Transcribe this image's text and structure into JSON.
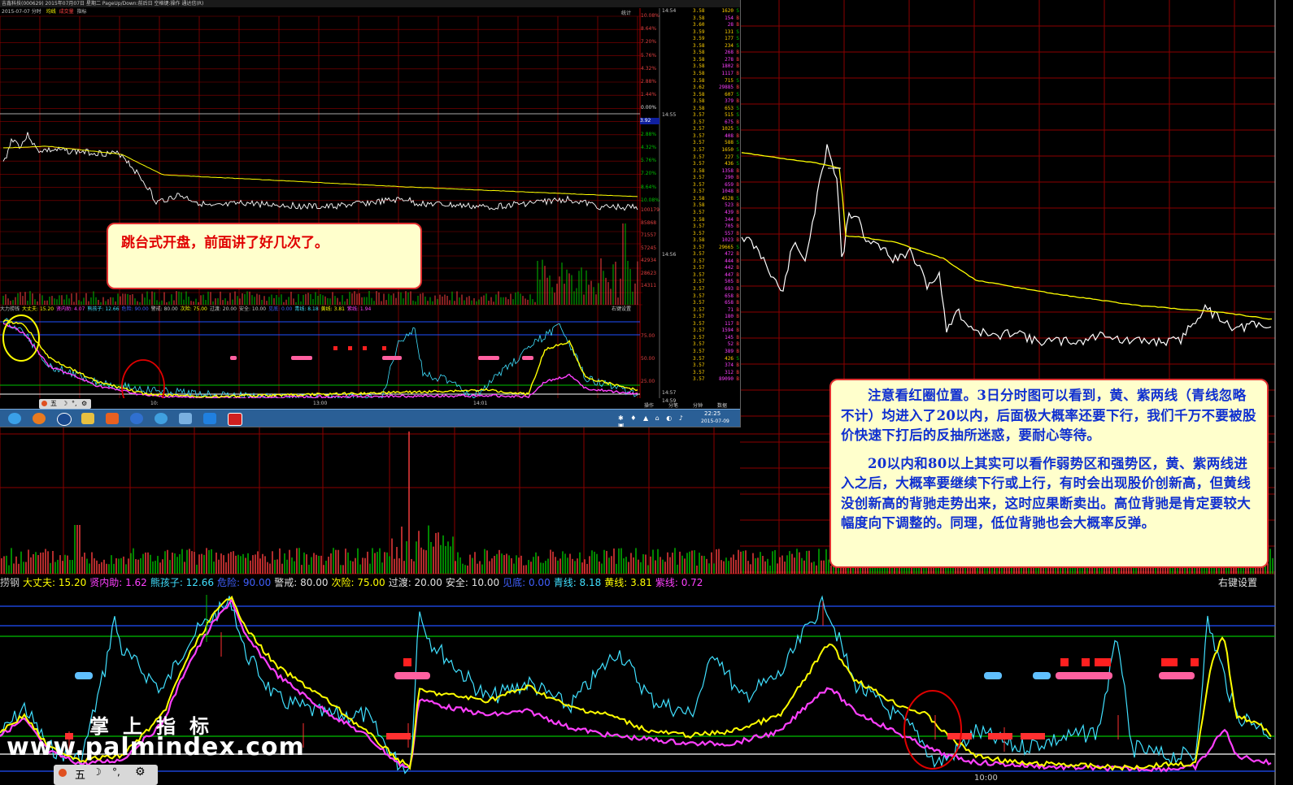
{
  "inner_window": {
    "title": "吉鑫科技(000629) 2015年07月07日 星期二 PageUp/Down:前后日 空格键:操作 通达信(R)",
    "info": "2015-07-07 分时",
    "legend": [
      "均线",
      "成交量",
      "指标"
    ],
    "stat_label": "统计",
    "pct_labels": [
      "10.08%",
      "8.64%",
      "7.20%",
      "5.76%",
      "4.32%",
      "2.88%",
      "1.44%",
      "0.00%",
      "1.44%",
      "2.88%",
      "4.32%",
      "5.76%",
      "7.20%",
      "8.64%",
      "10.08%"
    ],
    "vol_labels": [
      "100179",
      "85868",
      "71557",
      "57245",
      "42934",
      "28623",
      "14311"
    ],
    "current_price": "3.92",
    "x_labels": [
      "10:",
      "13:00",
      "14:01"
    ],
    "ind_labels": [
      "75.00",
      "50.00",
      "25.00"
    ],
    "indicator_line": [
      {
        "t": "大力捞钱",
        "c": "#c8c8c8"
      },
      {
        "t": "大丈夫: 15.20",
        "c": "#ffff00"
      },
      {
        "t": "贤内助: 4.07",
        "c": "#ff40ff"
      },
      {
        "t": "熊孩子: 12.66",
        "c": "#40e0ff"
      },
      {
        "t": "危险: 90.00",
        "c": "#4060ff"
      },
      {
        "t": "警戒: 80.00",
        "c": "#c8c8c8"
      },
      {
        "t": "次险: 75.00",
        "c": "#ffff00"
      },
      {
        "t": "过渡: 20.00",
        "c": "#c8c8c8"
      },
      {
        "t": "安全: 10.00",
        "c": "#c8c8c8"
      },
      {
        "t": "见底: 0.00",
        "c": "#4060ff"
      },
      {
        "t": "青线: 8.18",
        "c": "#40e0ff"
      },
      {
        "t": "黄线: 3.81",
        "c": "#ffff00"
      },
      {
        "t": "紫线: 1.94",
        "c": "#ff40ff"
      }
    ],
    "right_click": "右键设置",
    "tick_times": [
      "14:54",
      "14:55",
      "14:56",
      "14:57",
      "14:59"
    ],
    "ticks": [
      [
        "3.58",
        "1620",
        "S"
      ],
      [
        "3.58",
        "154",
        "B"
      ],
      [
        "3.60",
        "28",
        "B"
      ],
      [
        "3.59",
        "131",
        "S"
      ],
      [
        "3.59",
        "177",
        "S"
      ],
      [
        "3.58",
        "234",
        "S"
      ],
      [
        "3.58",
        "268",
        "B"
      ],
      [
        "3.58",
        "278",
        "B"
      ],
      [
        "3.58",
        "1802",
        "B"
      ],
      [
        "3.58",
        "1117",
        "B"
      ],
      [
        "3.58",
        "715",
        "S"
      ],
      [
        "3.62",
        "29885",
        "B"
      ],
      [
        "3.58",
        "607",
        "S"
      ],
      [
        "3.58",
        "379",
        "B"
      ],
      [
        "3.58",
        "653",
        "S"
      ],
      [
        "3.57",
        "515",
        "S"
      ],
      [
        "3.57",
        "675",
        "B"
      ],
      [
        "3.57",
        "1025",
        "S"
      ],
      [
        "3.57",
        "408",
        "B"
      ],
      [
        "3.57",
        "588",
        "S"
      ],
      [
        "3.57",
        "1650",
        "S"
      ],
      [
        "3.57",
        "227",
        "S"
      ],
      [
        "3.57",
        "436",
        "S"
      ],
      [
        "3.58",
        "1358",
        "B"
      ],
      [
        "3.57",
        "290",
        "B"
      ],
      [
        "3.57",
        "659",
        "B"
      ],
      [
        "3.57",
        "1048",
        "B"
      ],
      [
        "3.58",
        "4528",
        "S"
      ],
      [
        "3.58",
        "523",
        "B"
      ],
      [
        "3.57",
        "439",
        "B"
      ],
      [
        "3.58",
        "344",
        "B"
      ],
      [
        "3.57",
        "705",
        "B"
      ],
      [
        "3.57",
        "557",
        "B"
      ],
      [
        "3.58",
        "1023",
        "B"
      ],
      [
        "3.57",
        "29665",
        "S"
      ],
      [
        "3.57",
        "472",
        "B"
      ],
      [
        "3.57",
        "444",
        "B"
      ],
      [
        "3.57",
        "442",
        "B"
      ],
      [
        "3.57",
        "447",
        "B"
      ],
      [
        "3.57",
        "505",
        "B"
      ],
      [
        "3.57",
        "693",
        "B"
      ],
      [
        "3.57",
        "658",
        "B"
      ],
      [
        "3.57",
        "658",
        "B"
      ],
      [
        "3.57",
        "71",
        "B"
      ],
      [
        "3.57",
        "180",
        "B"
      ],
      [
        "3.57",
        "117",
        "B"
      ],
      [
        "3.57",
        "1594",
        "B"
      ],
      [
        "3.57",
        "145",
        "B"
      ],
      [
        "3.57",
        "52",
        "B"
      ],
      [
        "3.57",
        "389",
        "B"
      ],
      [
        "3.57",
        "426",
        "S"
      ],
      [
        "3.57",
        "374",
        "B"
      ],
      [
        "3.57",
        "312",
        "B"
      ],
      [
        "3.57",
        "89090",
        "B"
      ]
    ],
    "bottom_tabs": [
      "操作",
      "分笔",
      "分钟",
      "数据"
    ],
    "tray_time": "22:25",
    "tray_date": "2015-07-09",
    "mini_toolbar": "五"
  },
  "note1": "跳台式开盘，前面讲了好几次了。",
  "note2": [
    "注意看红圈位置。3日分时图可以看到，黄、紫两线（青线忽略不计）均进入了20以内，后面极大概率还要下行，我们千万不要被股价快速下打后的反抽所迷惑，要耐心等待。",
    "20以内和80以上其实可以看作弱势区和强势区，黄、紫两线进入之后，大概率要继续下行或上行，有时会出现股价创新高，但黄线没创新高的背驰走势出来，这时应果断卖出。高位背驰是肯定要较大幅度向下调整的。同理，低位背驰也会大概率反弹。"
  ],
  "indicator_bar": [
    {
      "t": "捞钢",
      "c": "#c8c8c8"
    },
    {
      "t": "大丈夫: 15.20",
      "c": "#ffff00"
    },
    {
      "t": "贤内助: 1.62",
      "c": "#ff40ff"
    },
    {
      "t": "熊孩子: 12.66",
      "c": "#40e0ff"
    },
    {
      "t": "危险: 90.00",
      "c": "#4060ff"
    },
    {
      "t": "警戒: 80.00",
      "c": "#e0e0e0"
    },
    {
      "t": "次险: 75.00",
      "c": "#ffff00"
    },
    {
      "t": "过渡: 20.00",
      "c": "#e0e0e0"
    },
    {
      "t": "安全: 10.00",
      "c": "#e0e0e0"
    },
    {
      "t": "见底: 0.00",
      "c": "#4060ff"
    },
    {
      "t": "青线: 8.18",
      "c": "#40e0ff"
    },
    {
      "t": "黄线: 3.81",
      "c": "#ffff00"
    },
    {
      "t": "紫线: 0.72",
      "c": "#ff40ff"
    }
  ],
  "right_click_main": "右键设置",
  "bottom_x_label": "10:00",
  "watermark_cn": "掌上指标",
  "watermark_url": "www.palmindex.com",
  "mini_toolbar_main": "五",
  "colors": {
    "grid": "#8b0000",
    "price": "#ffffff",
    "avg": "#ffff00",
    "yellow": "#ffff00",
    "magenta": "#ff40ff",
    "cyan": "#40e0ff",
    "blue": "#2050ff",
    "green": "#00c000",
    "vol_up": "#ff4040",
    "vol_dn": "#00c000",
    "note_bg": "#ffffcc",
    "note_border": "#e03030"
  }
}
